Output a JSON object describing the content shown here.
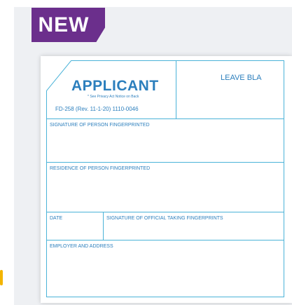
{
  "badge": {
    "label": "NEW",
    "color": "#6b2f8c"
  },
  "form": {
    "title": "APPLICANT",
    "privacy_note": "* See Privacy Act Notice on Back",
    "form_number": "FD-258 (Rev. 11-1-20) 1110-0046",
    "leave_blank": "LEAVE BLA",
    "fields": {
      "signature_fingerprinted": "SIGNATURE OF PERSON FINGERPRINTED",
      "residence": "RESIDENCE OF PERSON FINGERPRINTED",
      "date": "DATE",
      "signature_official": "SIGNATURE OF OFFICIAL TAKING FINGERPRINTS",
      "employer": "EMPLOYER AND ADDRESS"
    },
    "line_color": "#4bb3d8",
    "text_color": "#2c7fbd"
  }
}
